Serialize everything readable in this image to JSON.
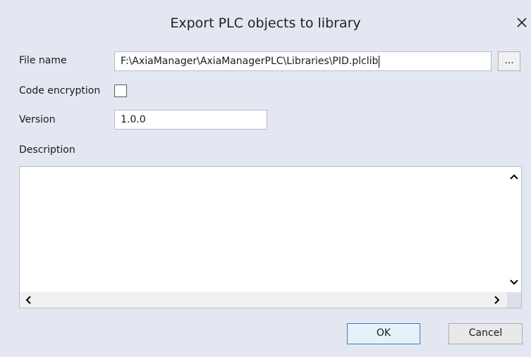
{
  "dialog": {
    "title": "Export PLC objects to library",
    "close_glyph": "✕"
  },
  "form": {
    "file_name": {
      "label": "File name",
      "value": "F:\\AxiaManager\\AxiaManagerPLC\\Libraries\\PID.plclib",
      "browse_label": "..."
    },
    "code_encryption": {
      "label": "Code encryption",
      "checked": false
    },
    "version": {
      "label": "Version",
      "value": "1.0.0"
    },
    "description": {
      "label": "Description",
      "value": ""
    }
  },
  "scrollbars": {
    "up": "▲",
    "down": "▼",
    "left": "◀",
    "right": "▶"
  },
  "buttons": {
    "ok_label": "OK",
    "cancel_label": "Cancel"
  },
  "icons": {
    "close": "close-icon",
    "browse": "ellipsis-icon",
    "scroll_up": "chevron-up-icon",
    "scroll_down": "chevron-down-icon",
    "scroll_left": "chevron-left-icon",
    "scroll_right": "chevron-right-icon"
  },
  "colors": {
    "dialog_background": "#e3e7f1",
    "ok_border": "#3c7fb1",
    "ok_background": "#e5f1fb"
  }
}
